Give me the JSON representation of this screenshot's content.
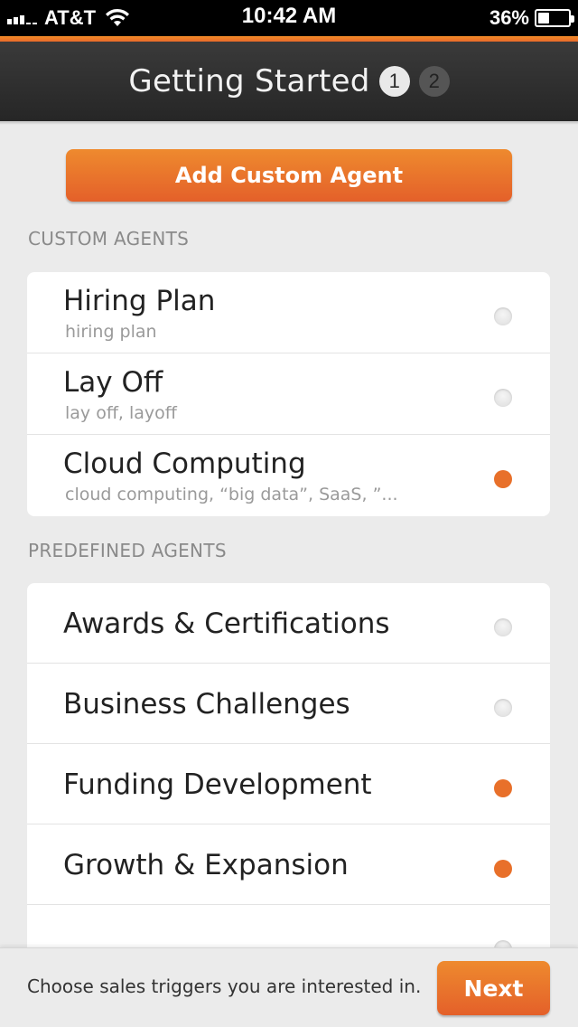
{
  "status_bar": {
    "carrier": "AT&T",
    "time": "10:42 AM",
    "battery": "36%",
    "battery_level": 0.36,
    "signal_icon": "signal-bars-icon",
    "wifi_icon": "wifi-icon",
    "battery_icon": "battery-icon"
  },
  "nav": {
    "title": "Getting Started",
    "steps": [
      "1",
      "2"
    ],
    "active_step": 1
  },
  "add_button_label": "Add Custom Agent",
  "custom_section_label": "CUSTOM AGENTS",
  "custom_agents": [
    {
      "title": "Hiring Plan",
      "keywords": "hiring plan",
      "selected": false
    },
    {
      "title": "Lay Off",
      "keywords": "lay off, layoff",
      "selected": false
    },
    {
      "title": "Cloud Computing",
      "keywords": "cloud computing, “big data”,  SaaS, ”...",
      "selected": true
    }
  ],
  "predefined_section_label": "PREDEFINED AGENTS",
  "predefined_agents": [
    {
      "title": "Awards & Certifications",
      "selected": false
    },
    {
      "title": "Business Challenges",
      "selected": false
    },
    {
      "title": "Funding Development",
      "selected": true
    },
    {
      "title": "Growth & Expansion",
      "selected": true
    },
    {
      "title": "",
      "selected": false
    }
  ],
  "footer": {
    "hint": "Choose sales triggers you are interested in.",
    "next_label": "Next"
  },
  "colors": {
    "accent": "#e8702a",
    "nav_bg": "#2e2e2e",
    "page_bg": "#ebebeb"
  }
}
